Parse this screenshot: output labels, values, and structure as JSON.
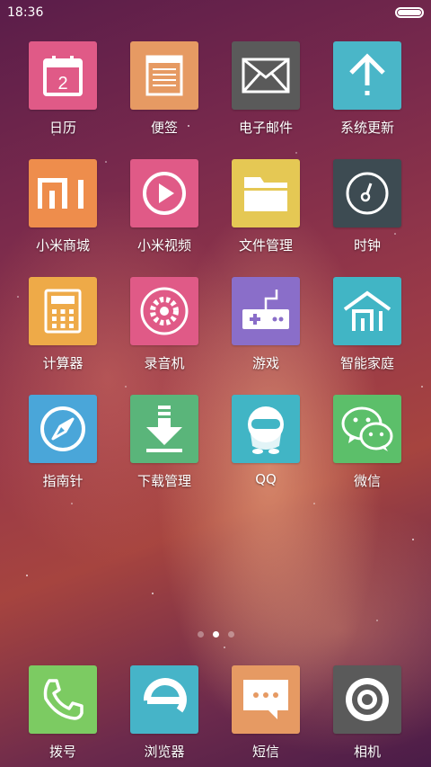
{
  "status_bar": {
    "time": "18:36",
    "battery_level": 1.0
  },
  "apps": [
    {
      "id": "calendar",
      "label": "日历",
      "color": "#e05a87",
      "icon": "calendar-icon",
      "day": "2"
    },
    {
      "id": "notes",
      "label": "便签",
      "color": "#e69a63",
      "icon": "notes-icon"
    },
    {
      "id": "email",
      "label": "电子邮件",
      "color": "#5a5a5a",
      "icon": "mail-icon"
    },
    {
      "id": "updater",
      "label": "系统更新",
      "color": "#4ab6c8",
      "icon": "arrow-up-icon"
    },
    {
      "id": "mistore",
      "label": "小米商城",
      "color": "#ee8d4c",
      "icon": "mi-logo-icon"
    },
    {
      "id": "mivideo",
      "label": "小米视频",
      "color": "#e05a87",
      "icon": "play-icon"
    },
    {
      "id": "files",
      "label": "文件管理",
      "color": "#e5c854",
      "icon": "folder-icon"
    },
    {
      "id": "clock",
      "label": "时钟",
      "color": "#3d4b52",
      "icon": "clock-icon"
    },
    {
      "id": "calculator",
      "label": "计算器",
      "color": "#eeaa48",
      "icon": "calculator-icon"
    },
    {
      "id": "recorder",
      "label": "录音机",
      "color": "#e05a87",
      "icon": "record-icon"
    },
    {
      "id": "games",
      "label": "游戏",
      "color": "#8a6ec9",
      "icon": "gamepad-icon"
    },
    {
      "id": "smarthome",
      "label": "智能家庭",
      "color": "#41b5c5",
      "icon": "smart-home-icon"
    },
    {
      "id": "compass",
      "label": "指南针",
      "color": "#4aa6d9",
      "icon": "compass-icon"
    },
    {
      "id": "downloads",
      "label": "下载管理",
      "color": "#5ab57a",
      "icon": "download-icon"
    },
    {
      "id": "qq",
      "label": "QQ",
      "color": "#41b5c5",
      "icon": "qq-penguin-icon"
    },
    {
      "id": "wechat",
      "label": "微信",
      "color": "#5cbf6a",
      "icon": "wechat-icon"
    }
  ],
  "dock": [
    {
      "id": "phone",
      "label": "拨号",
      "color": "#7ccb62",
      "icon": "phone-icon"
    },
    {
      "id": "browser",
      "label": "浏览器",
      "color": "#46b4c8",
      "icon": "browser-e-icon"
    },
    {
      "id": "messages",
      "label": "短信",
      "color": "#e69a63",
      "icon": "message-icon"
    },
    {
      "id": "camera",
      "label": "相机",
      "color": "#5a5a5a",
      "icon": "camera-icon"
    }
  ],
  "pager": {
    "pages": 3,
    "current": 2
  }
}
